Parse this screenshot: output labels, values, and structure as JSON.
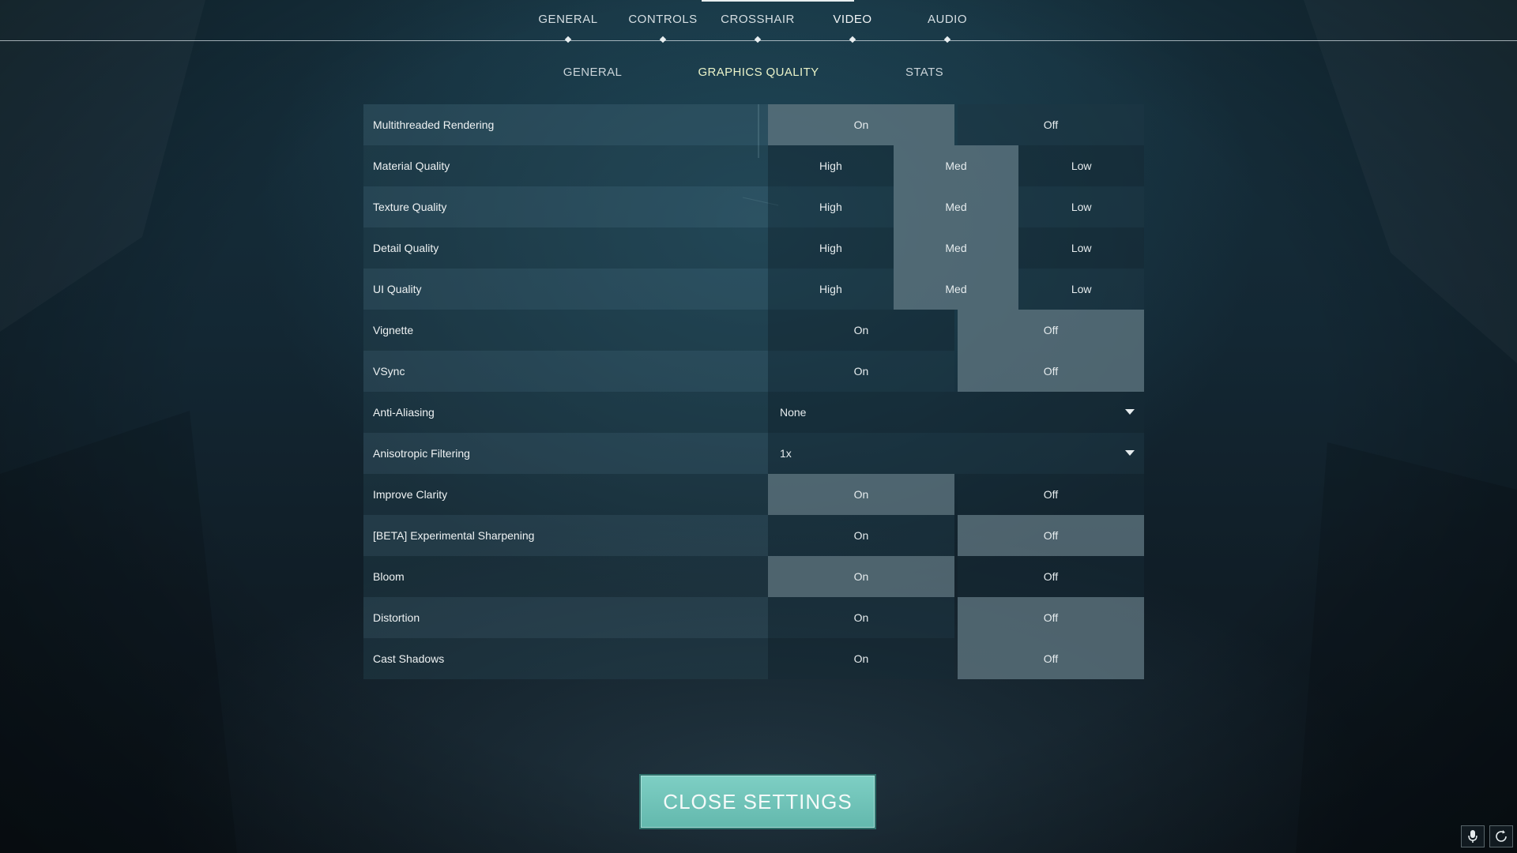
{
  "top_tabs": [
    {
      "label": "GENERAL"
    },
    {
      "label": "CONTROLS"
    },
    {
      "label": "CROSSHAIR"
    },
    {
      "label": "VIDEO"
    },
    {
      "label": "AUDIO"
    }
  ],
  "top_tabs_active": "VIDEO",
  "sub_tabs": [
    {
      "label": "GENERAL"
    },
    {
      "label": "GRAPHICS QUALITY"
    },
    {
      "label": "STATS"
    }
  ],
  "sub_tabs_active": "GRAPHICS QUALITY",
  "settings": [
    {
      "label": "Multithreaded Rendering",
      "options": [
        "On",
        "Off"
      ],
      "selected": "On"
    },
    {
      "label": "Material Quality",
      "options": [
        "High",
        "Med",
        "Low"
      ],
      "selected": "Med"
    },
    {
      "label": "Texture Quality",
      "options": [
        "High",
        "Med",
        "Low"
      ],
      "selected": "Med"
    },
    {
      "label": "Detail Quality",
      "options": [
        "High",
        "Med",
        "Low"
      ],
      "selected": "Med"
    },
    {
      "label": "UI Quality",
      "options": [
        "High",
        "Med",
        "Low"
      ],
      "selected": "Med"
    },
    {
      "label": "Vignette",
      "options": [
        "On",
        "Off"
      ],
      "selected": "Off"
    },
    {
      "label": "VSync",
      "options": [
        "On",
        "Off"
      ],
      "selected": "Off"
    },
    {
      "label": "Anti-Aliasing",
      "dropdown": "None"
    },
    {
      "label": "Anisotropic Filtering",
      "dropdown": "1x"
    },
    {
      "label": "Improve Clarity",
      "options": [
        "On",
        "Off"
      ],
      "selected": "On"
    },
    {
      "label": "[BETA] Experimental Sharpening",
      "options": [
        "On",
        "Off"
      ],
      "selected": "Off"
    },
    {
      "label": "Bloom",
      "options": [
        "On",
        "Off"
      ],
      "selected": "On"
    },
    {
      "label": "Distortion",
      "options": [
        "On",
        "Off"
      ],
      "selected": "Off"
    },
    {
      "label": "Cast Shadows",
      "options": [
        "On",
        "Off"
      ],
      "selected": "Off"
    }
  ],
  "close_button": {
    "label": "CLOSE SETTINGS"
  },
  "corner_icons": [
    "microphone-icon",
    "refresh-icon"
  ],
  "colors": {
    "accent": "#6fc3b8",
    "selected": "#5f7680",
    "sub_tab_active": "#eaf3c9"
  }
}
